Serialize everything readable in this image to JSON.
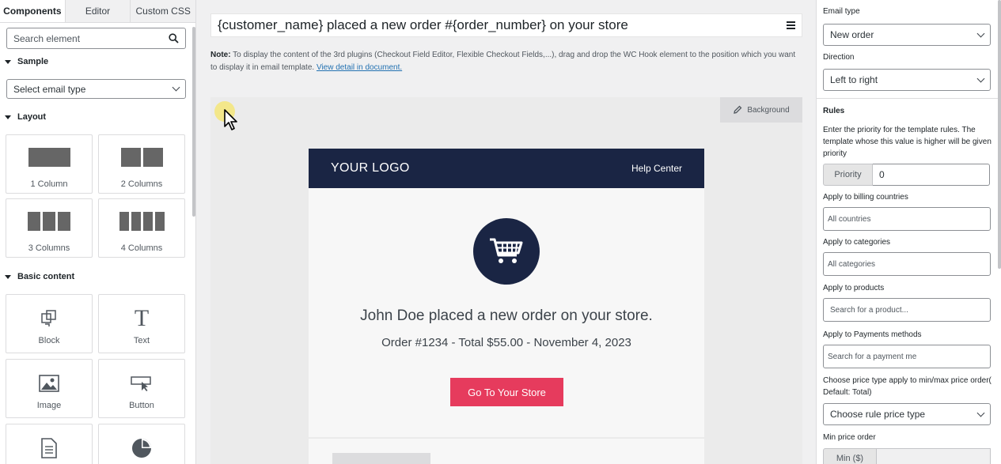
{
  "left_panel": {
    "tabs": [
      {
        "label": "Components",
        "active": true
      },
      {
        "label": "Editor",
        "active": false
      },
      {
        "label": "Custom CSS",
        "active": false
      }
    ],
    "search_placeholder": "Search element",
    "sample": {
      "heading": "Sample",
      "select_value": "Select email type"
    },
    "layout": {
      "heading": "Layout",
      "items": [
        {
          "label": "1 Column",
          "icon": "one-column-icon"
        },
        {
          "label": "2 Columns",
          "icon": "two-columns-icon"
        },
        {
          "label": "3 Columns",
          "icon": "three-columns-icon"
        },
        {
          "label": "4 Columns",
          "icon": "four-columns-icon"
        }
      ]
    },
    "basic_content": {
      "heading": "Basic content",
      "items": [
        {
          "label": "Block",
          "icon": "block-icon"
        },
        {
          "label": "Text",
          "icon": "text-icon"
        },
        {
          "label": "Image",
          "icon": "image-icon"
        },
        {
          "label": "Button",
          "icon": "button-icon"
        },
        {
          "label": "",
          "icon": "document-icon"
        },
        {
          "label": "",
          "icon": "pie-chart-icon"
        }
      ]
    }
  },
  "editor": {
    "subject": "{customer_name} placed a new order #{order_number} on your store",
    "note_label": "Note:",
    "note_text": " To display the content of the 3rd plugins (Checkout Field Editor, Flexible Checkout Fields,...), drag and drop the WC Hook element to the position which you want to display it in email template. ",
    "note_link": "View detail in document.",
    "background_button": "Background"
  },
  "email": {
    "logo": "YOUR LOGO",
    "help_center": "Help Center",
    "headline": "John Doe placed a new order on your store.",
    "order_line": "Order #1234 - Total $55.00 - November 4, 2023",
    "cta": "Go To Your Store",
    "colors": {
      "header": "#1a2544",
      "cta": "#e63b5d"
    }
  },
  "settings": {
    "email_type_label": "Email type",
    "email_type_value": "New order",
    "direction_label": "Direction",
    "direction_value": "Left to right",
    "rules_heading": "Rules",
    "rules_desc": "Enter the priority for the template rules. The template whose this value is higher will be given priority",
    "priority_label": "Priority",
    "priority_value": "0",
    "billing_label": "Apply to billing countries",
    "billing_value": "All countries",
    "categories_label": "Apply to categories",
    "categories_value": "All categories",
    "products_label": "Apply to products",
    "products_placeholder": "Search for a product...",
    "payments_label": "Apply to Payments methods",
    "payments_placeholder": "Search for a payment me",
    "price_type_label": "Choose price type apply to min/max price order( Default: Total)",
    "price_type_value": "Choose rule price type",
    "min_price_label": "Min price order",
    "min_tag": "Min ($)"
  }
}
